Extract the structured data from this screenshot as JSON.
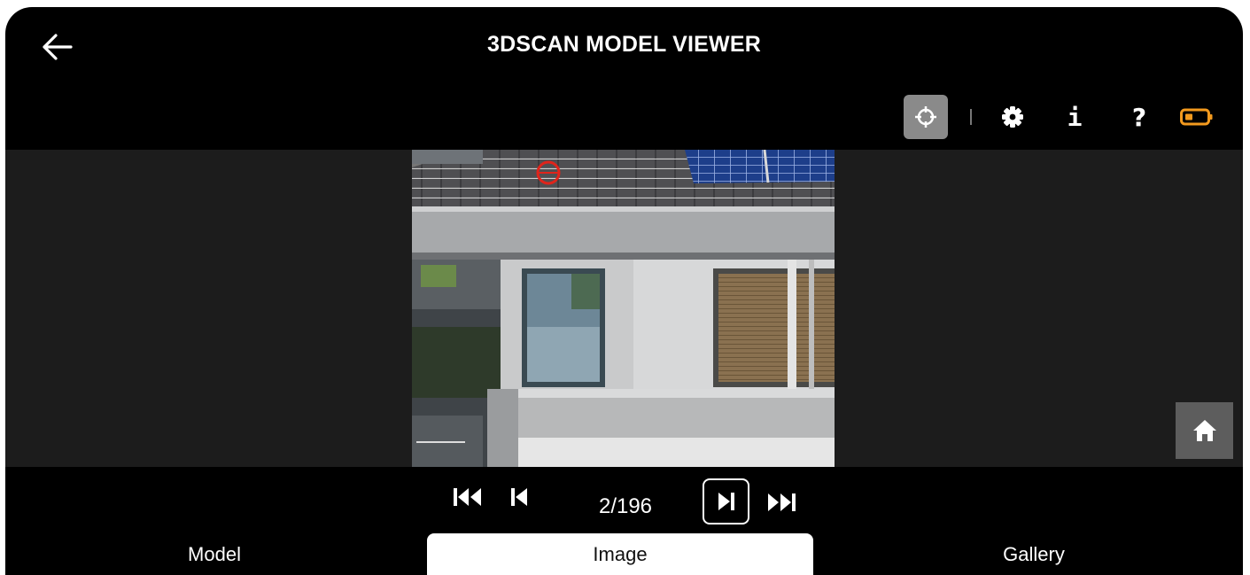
{
  "header": {
    "title": "3DSCAN MODEL VIEWER"
  },
  "icons": {
    "back": "arrow-left-icon",
    "target": "crosshair-icon",
    "settings": "gear-icon",
    "info": "i",
    "help": "?",
    "battery": "battery-icon",
    "home": "home-icon"
  },
  "colors": {
    "accent": "#f39a1e",
    "marker": "#e0241b",
    "active_tab_bg": "#ffffff",
    "background": "#000000"
  },
  "navigation": {
    "counter": "2/196"
  },
  "tabs": [
    {
      "label": "Model",
      "active": false
    },
    {
      "label": "Image",
      "active": true
    },
    {
      "label": "Gallery",
      "active": false
    }
  ]
}
